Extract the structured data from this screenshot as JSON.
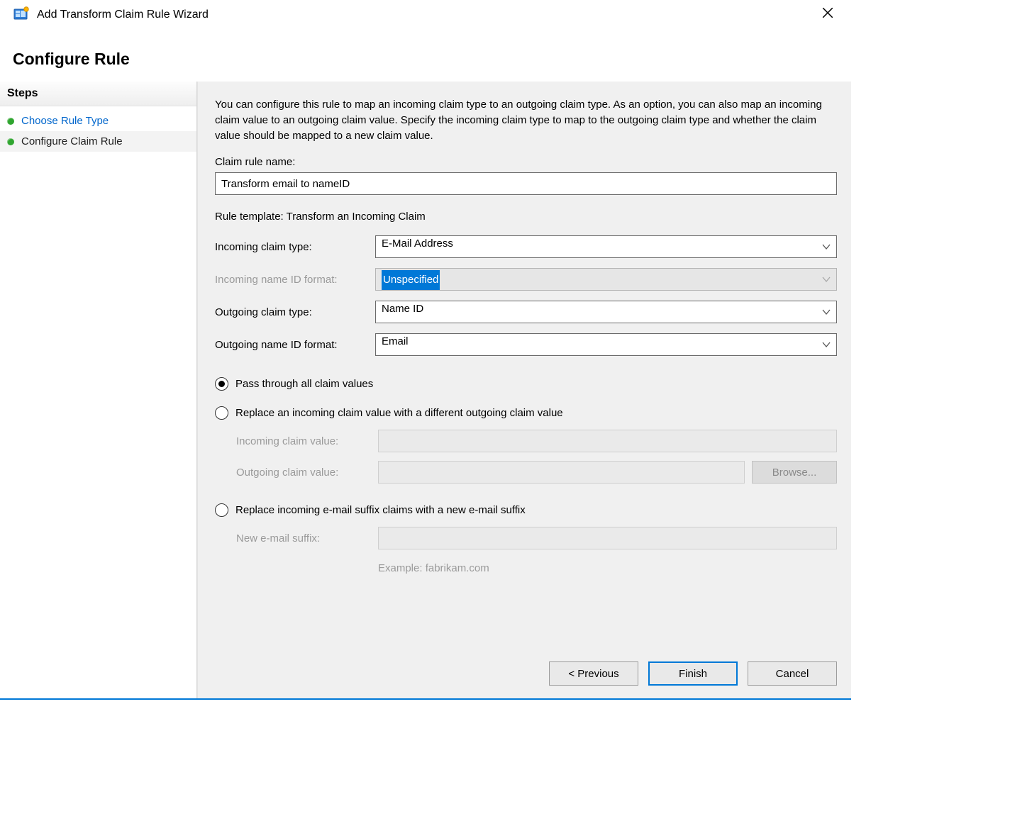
{
  "window": {
    "title": "Add Transform Claim Rule Wizard"
  },
  "page_header": "Configure Rule",
  "sidebar": {
    "header": "Steps",
    "steps": [
      {
        "label": "Choose Rule Type"
      },
      {
        "label": "Configure Claim Rule"
      }
    ]
  },
  "intro": "You can configure this rule to map an incoming claim type to an outgoing claim type. As an option, you can also map an incoming claim value to an outgoing claim value. Specify the incoming claim type to map to the outgoing claim type and whether the claim value should be mapped to a new claim value.",
  "labels": {
    "claim_rule_name": "Claim rule name:",
    "rule_template": "Rule template: Transform an Incoming Claim",
    "incoming_claim_type": "Incoming claim type:",
    "incoming_name_id_format": "Incoming name ID format:",
    "outgoing_claim_type": "Outgoing claim type:",
    "outgoing_name_id_format": "Outgoing name ID format:",
    "incoming_claim_value": "Incoming claim value:",
    "outgoing_claim_value": "Outgoing claim value:",
    "new_email_suffix": "New e-mail suffix:",
    "example": "Example: fabrikam.com",
    "browse": "Browse..."
  },
  "values": {
    "claim_rule_name": "Transform email to nameID",
    "incoming_claim_type": "E-Mail Address",
    "incoming_name_id_format": "Unspecified",
    "outgoing_claim_type": "Name ID",
    "outgoing_name_id_format": "Email"
  },
  "radios": {
    "pass_through": "Pass through all claim values",
    "replace_value": "Replace an incoming claim value with a different outgoing claim value",
    "replace_suffix": "Replace incoming e-mail suffix claims with a new e-mail suffix",
    "selected": "pass_through"
  },
  "footer": {
    "previous": "< Previous",
    "finish": "Finish",
    "cancel": "Cancel"
  }
}
